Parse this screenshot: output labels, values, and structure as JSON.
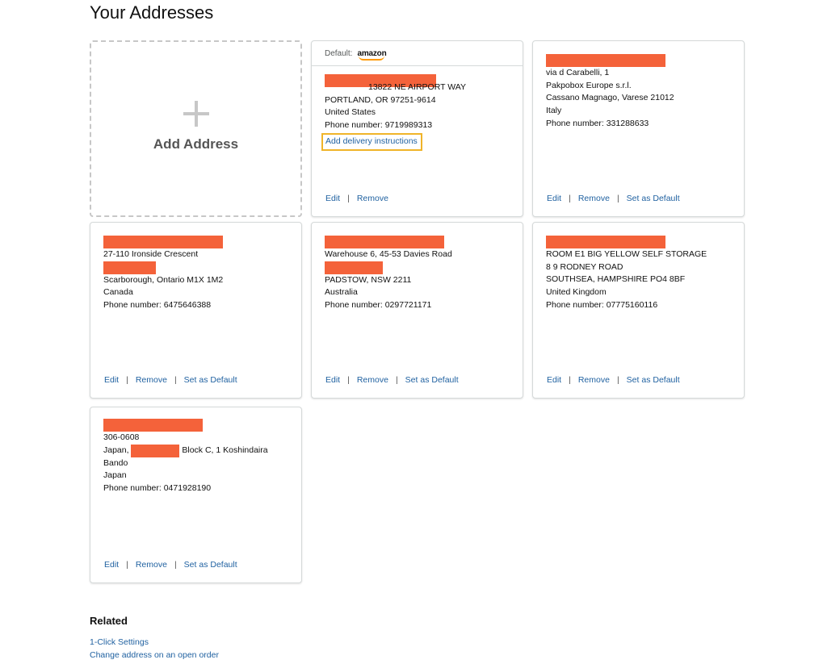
{
  "page": {
    "title": "Your Addresses"
  },
  "add_address": {
    "label": "Add Address"
  },
  "default_header": {
    "label": "Default:",
    "brand": "amazon"
  },
  "addresses": [
    {
      "lines": [
        "13822 NE AIRPORT WAY",
        "PORTLAND, OR 97251-9614",
        "United States",
        "Phone number: 9719989313"
      ],
      "delivery_link": "Add delivery instructions",
      "actions": [
        "Edit",
        "Remove"
      ]
    },
    {
      "lines": [
        "via d Carabelli, 1",
        "Pakpobox Europe s.r.l.",
        "Cassano Magnago, Varese 21012",
        "Italy",
        "Phone number: 331288633"
      ],
      "actions": [
        "Edit",
        "Remove",
        "Set as Default"
      ]
    },
    {
      "lines": [
        "27-110 Ironside Crescent",
        "Scarborough, Ontario M1X 1M2",
        "Canada",
        "Phone number: 6475646388"
      ],
      "actions": [
        "Edit",
        "Remove",
        "Set as Default"
      ]
    },
    {
      "lines": [
        "Warehouse 6, 45-53 Davies Road",
        "PADSTOW, NSW 2211",
        "Australia",
        "Phone number: 0297721171"
      ],
      "actions": [
        "Edit",
        "Remove",
        "Set as Default"
      ]
    },
    {
      "lines": [
        "ROOM E1 BIG YELLOW SELF STORAGE",
        "8 9 RODNEY ROAD",
        "SOUTHSEA, HAMPSHIRE PO4 8BF",
        "United Kingdom",
        "Phone number: 07775160116"
      ],
      "actions": [
        "Edit",
        "Remove",
        "Set as Default"
      ]
    },
    {
      "lines": [
        "306-0608",
        "Japan,",
        "Block C, 1 Koshindaira",
        "Bando",
        "Japan",
        "Phone number: 0471928190"
      ],
      "actions": [
        "Edit",
        "Remove",
        "Set as Default"
      ]
    }
  ],
  "related": {
    "title": "Related",
    "links": [
      "1-Click Settings",
      "Change address on an open order"
    ]
  },
  "colors": {
    "link": "#2162a1",
    "redaction": "#f4623a",
    "highlight": "#f0b429",
    "brand_accent": "#ff9900"
  }
}
